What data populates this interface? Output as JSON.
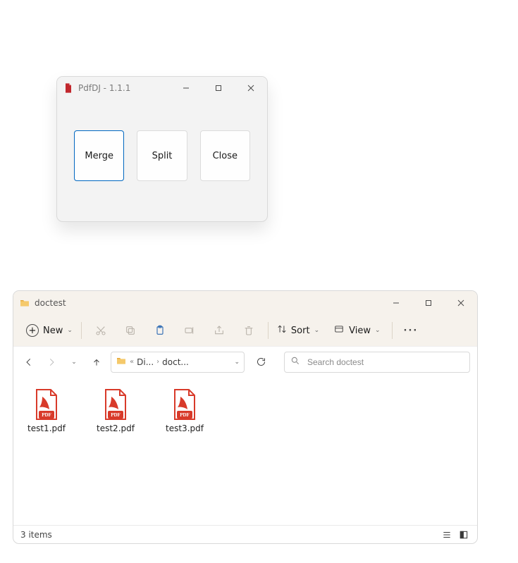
{
  "pdfdj": {
    "title": "PdfDJ - 1.1.1",
    "buttons": {
      "merge": "Merge",
      "split": "Split",
      "close": "Close"
    }
  },
  "explorer": {
    "title": "doctest",
    "toolbar": {
      "new_label": "New",
      "sort_label": "Sort",
      "view_label": "View"
    },
    "breadcrumb": {
      "seg1": "Di...",
      "seg2": "doct..."
    },
    "search": {
      "placeholder": "Search doctest"
    },
    "files": [
      {
        "name": "test1.pdf"
      },
      {
        "name": "test2.pdf"
      },
      {
        "name": "test3.pdf"
      }
    ],
    "status": "3 items"
  }
}
